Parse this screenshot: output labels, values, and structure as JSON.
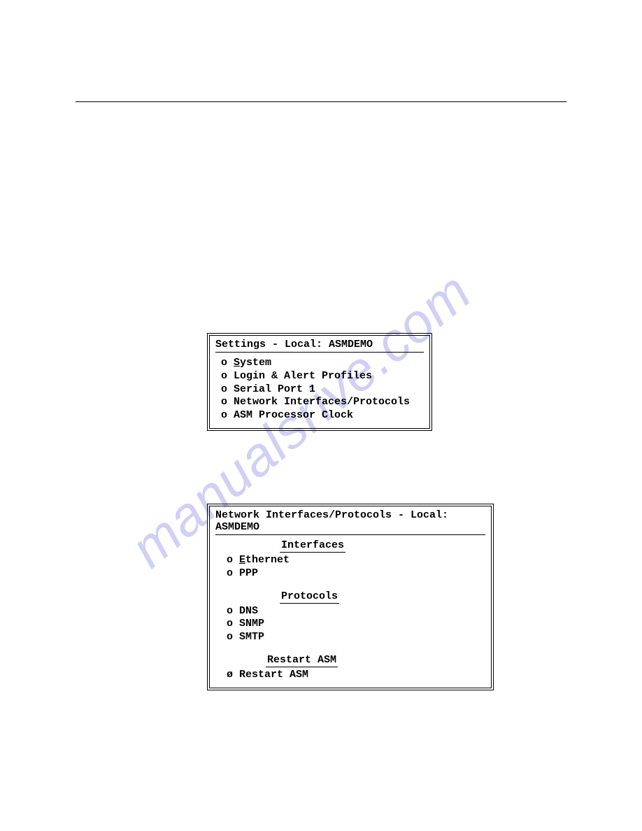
{
  "watermark": "manualsrive.com",
  "dialog1": {
    "title": "Settings - Local: ASMDEMO",
    "items": [
      {
        "marker": "o",
        "prefix": "S",
        "rest": "ystem"
      },
      {
        "marker": "o",
        "prefix": "",
        "rest": "Login & Alert Profiles"
      },
      {
        "marker": "o",
        "prefix": "",
        "rest": "Serial Port 1"
      },
      {
        "marker": "o",
        "prefix": "",
        "rest": "Network Interfaces/Protocols"
      },
      {
        "marker": "o",
        "prefix": "",
        "rest": "ASM Processor Clock"
      }
    ]
  },
  "dialog2": {
    "title": "Network Interfaces/Protocols - Local: ASMDEMO",
    "sections": [
      {
        "heading": "Interfaces",
        "items": [
          {
            "marker": "o",
            "prefix": "E",
            "rest": "thernet"
          },
          {
            "marker": "o",
            "prefix": "",
            "rest": "PPP"
          }
        ]
      },
      {
        "heading": "Protocols",
        "items": [
          {
            "marker": "o",
            "prefix": "",
            "rest": "DNS"
          },
          {
            "marker": "o",
            "prefix": "",
            "rest": "SNMP"
          },
          {
            "marker": "o",
            "prefix": "",
            "rest": "SMTP"
          }
        ]
      },
      {
        "heading": "Restart ASM",
        "items": [
          {
            "marker": "ø",
            "prefix": "",
            "rest": "Restart ASM"
          }
        ]
      }
    ]
  }
}
